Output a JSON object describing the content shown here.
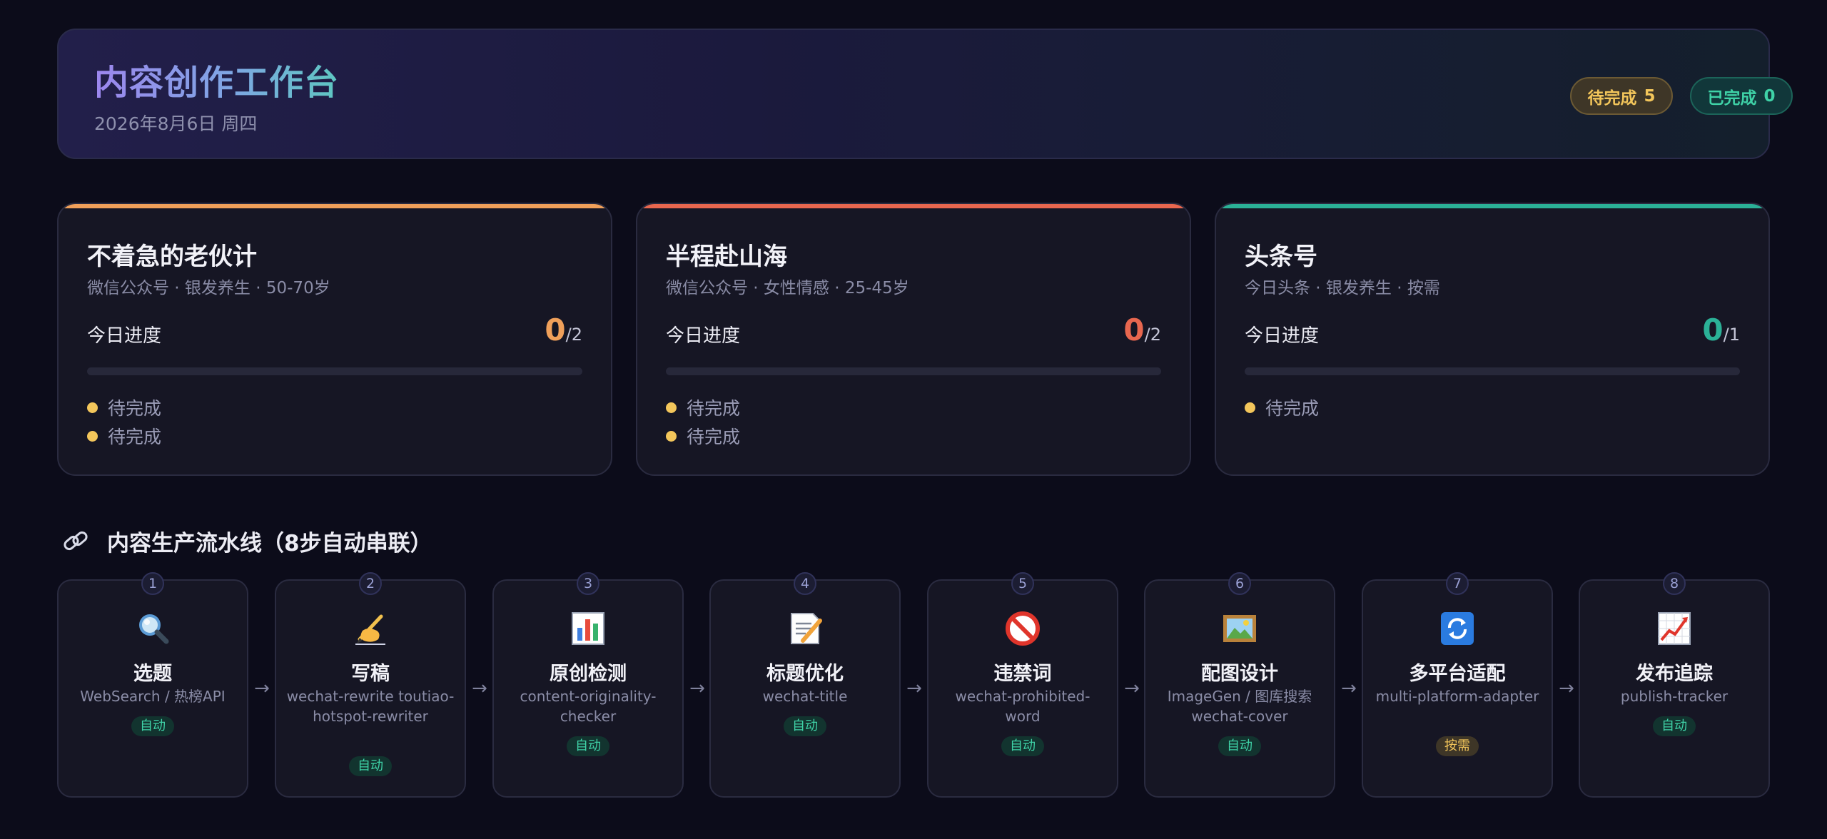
{
  "header": {
    "title": "内容创作工作台",
    "date": "2026年8月6日 周四",
    "pending_label": "待完成",
    "pending_count": "5",
    "done_label": "已完成",
    "done_count": "0"
  },
  "accounts": [
    {
      "name": "不着急的老伙计",
      "meta": "微信公众号 · 银发养生 · 50-70岁",
      "progress_label": "今日进度",
      "done": "0",
      "total": "/2",
      "progress": 0,
      "accent": "#f0a05a",
      "tasks": [
        "待完成",
        "待完成"
      ]
    },
    {
      "name": "半程赴山海",
      "meta": "微信公众号 · 女性情感 · 25-45岁",
      "progress_label": "今日进度",
      "done": "0",
      "total": "/2",
      "progress": 0,
      "accent": "#e8674f",
      "tasks": [
        "待完成",
        "待完成"
      ]
    },
    {
      "name": "头条号",
      "meta": "今日头条 · 银发养生 · 按需",
      "progress_label": "今日进度",
      "done": "0",
      "total": "/1",
      "progress": 0,
      "accent": "#2bb197",
      "tasks": [
        "待完成"
      ]
    }
  ],
  "pipeline": {
    "title": "内容生产流水线（8步自动串联）",
    "arrow": "→",
    "steps": [
      {
        "num": "1",
        "icon": "magnifier-icon",
        "name": "选题",
        "tool": "WebSearch / 热榜API",
        "tag": "自动"
      },
      {
        "num": "2",
        "icon": "writing-hand-icon",
        "name": "写稿",
        "tool": "wechat-rewrite toutiao-hotspot-rewriter",
        "tag": "自动"
      },
      {
        "num": "3",
        "icon": "bar-chart-icon",
        "name": "原创检测",
        "tool": "content-originality-checker",
        "tag": "自动"
      },
      {
        "num": "4",
        "icon": "memo-icon",
        "name": "标题优化",
        "tool": "wechat-title",
        "tag": "自动"
      },
      {
        "num": "5",
        "icon": "prohibited-icon",
        "name": "违禁词",
        "tool": "wechat-prohibited-word",
        "tag": "自动"
      },
      {
        "num": "6",
        "icon": "framed-picture-icon",
        "name": "配图设计",
        "tool": "ImageGen / 图库搜索 wechat-cover",
        "tag": "自动"
      },
      {
        "num": "7",
        "icon": "refresh-icon",
        "name": "多平台适配",
        "tool": "multi-platform-adapter",
        "tag": "按需"
      },
      {
        "num": "8",
        "icon": "trend-chart-icon",
        "name": "发布追踪",
        "tool": "publish-tracker",
        "tag": "自动"
      }
    ]
  },
  "colors": {
    "pending": "#f3c65b",
    "done": "#3fd2a7",
    "auto_tag": "#3fd2a7",
    "need_tag": "#f3c65b"
  }
}
